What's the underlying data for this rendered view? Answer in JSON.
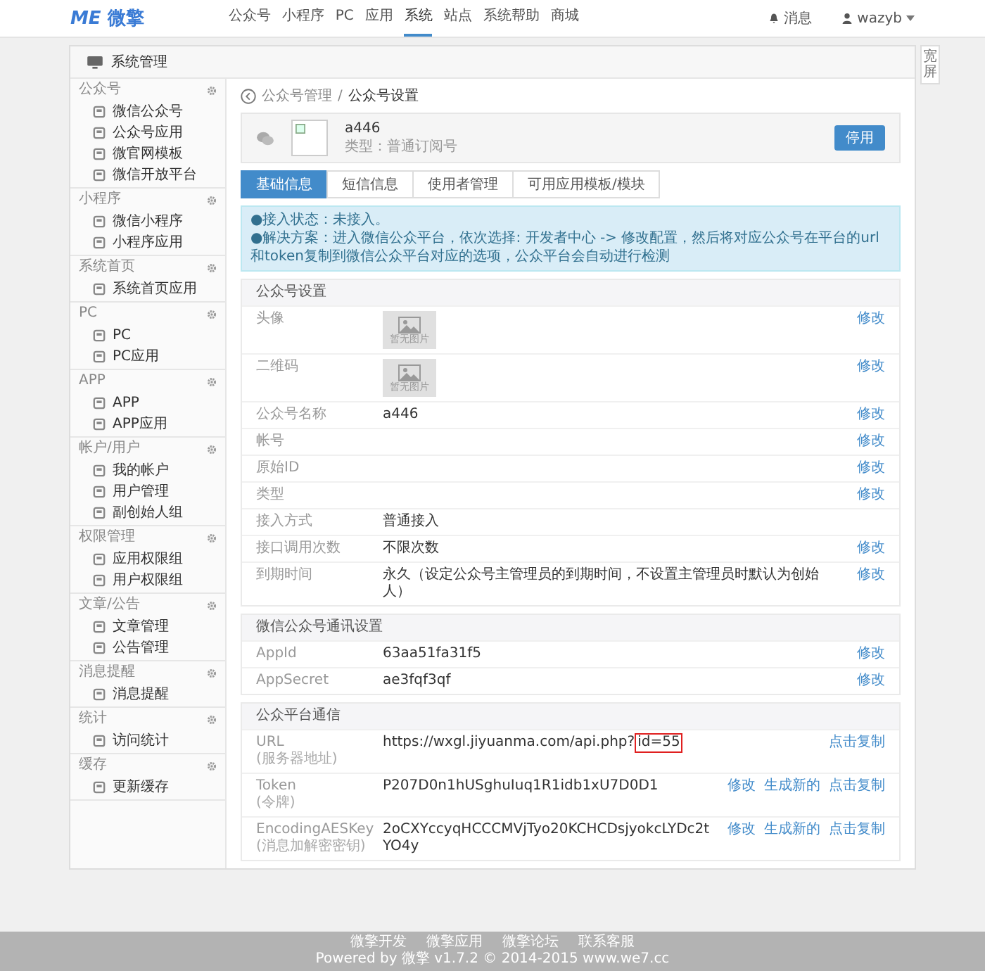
{
  "header": {
    "logo_mark": "ME",
    "logo_text": "微擎",
    "nav": [
      {
        "label": "公众号",
        "selected": false
      },
      {
        "label": "小程序",
        "selected": false
      },
      {
        "label": "PC",
        "selected": false
      },
      {
        "label": "应用",
        "selected": false
      },
      {
        "label": "系统",
        "selected": true
      },
      {
        "label": "站点",
        "selected": false
      },
      {
        "label": "系统帮助",
        "selected": false
      },
      {
        "label": "商城",
        "selected": false
      }
    ],
    "messages": "消息",
    "user": "wazyb"
  },
  "side_toggle": "宽屏",
  "panel_title": "系统管理",
  "sidebar": [
    {
      "title": "公众号",
      "items": [
        "微信公众号",
        "公众号应用",
        "微官网模板",
        "微信开放平台"
      ]
    },
    {
      "title": "小程序",
      "items": [
        "微信小程序",
        "小程序应用"
      ]
    },
    {
      "title": "系统首页",
      "items": [
        "系统首页应用"
      ]
    },
    {
      "title": "PC",
      "items": [
        "PC",
        "PC应用"
      ]
    },
    {
      "title": "APP",
      "items": [
        "APP",
        "APP应用"
      ]
    },
    {
      "title": "帐户/用户",
      "items": [
        "我的帐户",
        "用户管理",
        "副创始人组"
      ]
    },
    {
      "title": "权限管理",
      "items": [
        "应用权限组",
        "用户权限组"
      ]
    },
    {
      "title": "文章/公告",
      "items": [
        "文章管理",
        "公告管理"
      ]
    },
    {
      "title": "消息提醒",
      "items": [
        "消息提醒"
      ]
    },
    {
      "title": "统计",
      "items": [
        "访问统计"
      ]
    },
    {
      "title": "缓存",
      "items": [
        "更新缓存"
      ]
    }
  ],
  "breadcrumb": {
    "parent": "公众号管理",
    "separator": "/",
    "current": "公众号设置"
  },
  "account": {
    "name": "a446",
    "type": "类型：普通订阅号",
    "button": "停用"
  },
  "tabs": [
    {
      "label": "基础信息",
      "selected": true
    },
    {
      "label": "短信信息",
      "selected": false
    },
    {
      "label": "使用者管理",
      "selected": false
    },
    {
      "label": "可用应用模板/模块",
      "selected": false
    }
  ],
  "alert": [
    "●接入状态：未接入。",
    "●解决方案：进入微信公众平台，依次选择: 开发者中心 -> 修改配置，然后将对应公众号在平台的url和token复制到微信公众平台对应的选项，公众平台会自动进行检测"
  ],
  "sections": [
    {
      "title": "公众号设置",
      "rows": [
        {
          "kind": "image",
          "label": "头像",
          "image_text": "暂无图片",
          "actions": [
            "修改"
          ]
        },
        {
          "kind": "image",
          "label": "二维码",
          "image_text": "暂无图片",
          "actions": [
            "修改"
          ]
        },
        {
          "kind": "text",
          "label": "公众号名称",
          "value": "a446",
          "actions": [
            "修改"
          ]
        },
        {
          "kind": "text",
          "label": "帐号",
          "actions": [
            "修改"
          ]
        },
        {
          "kind": "text",
          "label": "原始ID",
          "actions": [
            "修改"
          ]
        },
        {
          "kind": "text",
          "label": "类型",
          "actions": [
            "修改"
          ]
        },
        {
          "kind": "text",
          "label": "接入方式",
          "value": "普通接入"
        },
        {
          "kind": "text",
          "label": "接口调用次数",
          "value": "不限次数",
          "actions": [
            "修改"
          ]
        },
        {
          "kind": "text",
          "label": "到期时间",
          "value": "永久（设定公众号主管理员的到期时间，不设置主管理员时默认为创始人）",
          "actions": [
            "修改"
          ]
        }
      ]
    },
    {
      "title": "微信公众号通讯设置",
      "rows": [
        {
          "kind": "text",
          "label": "AppId",
          "value": "63aa51fa31f5",
          "actions": [
            "修改"
          ]
        },
        {
          "kind": "text",
          "label": "AppSecret",
          "value": "ae3fqf3qf",
          "actions": [
            "修改"
          ]
        }
      ]
    },
    {
      "title": "公众平台通信",
      "rows": [
        {
          "kind": "text",
          "label": "URL",
          "sublabel": "(服务器地址)",
          "value": "https://wxgl.jiyuanma.com/api.php?",
          "highlight": "id=55",
          "actions": [
            "点击复制"
          ]
        },
        {
          "kind": "text",
          "label": "Token",
          "sublabel": "(令牌)",
          "value": "P207D0n1hUSghuIuq1R1idb1xU7D0D1",
          "actions": [
            "修改",
            "生成新的",
            "点击复制"
          ]
        },
        {
          "kind": "text",
          "label": "EncodingAESKey",
          "sublabel": "(消息加解密密钥)",
          "value": "2oCXYccyqHCCCMVjTyo20KCHCDsjyokcLYDc2tYO4y",
          "actions": [
            "修改",
            "生成新的",
            "点击复制"
          ]
        }
      ]
    }
  ],
  "footer": {
    "links": [
      "微擎开发",
      "微擎应用",
      "微擎论坛",
      "联系客服"
    ],
    "copyright": "Powered by 微擎 v1.7.2 © 2014-2015 www.we7.cc"
  }
}
